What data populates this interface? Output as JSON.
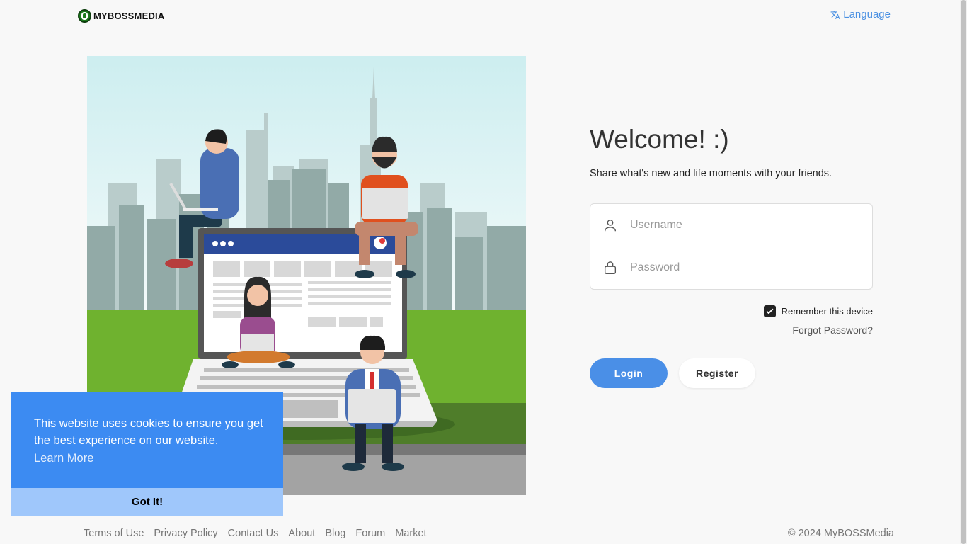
{
  "header": {
    "logo_text": "MYBOSSMEDIA",
    "language_label": "Language"
  },
  "main": {
    "title": "Welcome! :)",
    "subtitle": "Share what's new and life moments with your friends.",
    "username_placeholder": "Username",
    "password_placeholder": "Password",
    "remember_label": "Remember this device",
    "remember_checked": true,
    "forgot_label": "Forgot Password?",
    "login_label": "Login",
    "register_label": "Register"
  },
  "cookie": {
    "message": "This website uses cookies to ensure you get the best experience on our website.",
    "learn_more": "Learn More",
    "accept": "Got It!"
  },
  "footer": {
    "links": [
      "Terms of Use",
      "Privacy Policy",
      "Contact Us",
      "About",
      "Blog",
      "Forum",
      "Market"
    ],
    "copyright": "© 2024 MyBOSSMedia"
  },
  "colors": {
    "accent": "#4a8fe7",
    "cookie_bg": "#3c8bf2",
    "cookie_button": "#9fc7fb",
    "link": "#4a90e2"
  },
  "icons": {
    "language": "translate-icon",
    "username": "user-icon",
    "password": "lock-icon",
    "remember": "checkbox-checked-icon"
  }
}
